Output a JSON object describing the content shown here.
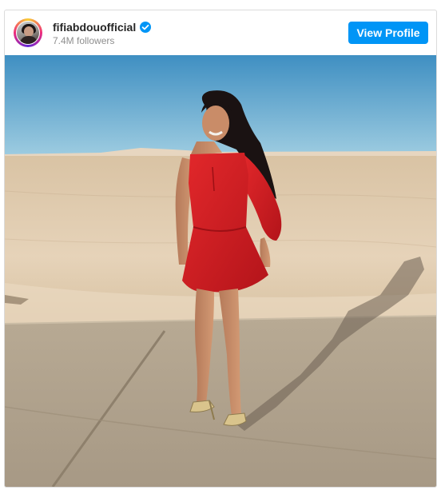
{
  "post": {
    "username": "fifiabdouofficial",
    "followers": "7.4M followers",
    "view_profile_label": "View Profile",
    "verified": true,
    "accent_color": "#0095f6"
  },
  "photo": {
    "dress_color": "#d01a1e",
    "sky_color": "#4a9cc9",
    "sand_color": "#e2cdb0"
  }
}
